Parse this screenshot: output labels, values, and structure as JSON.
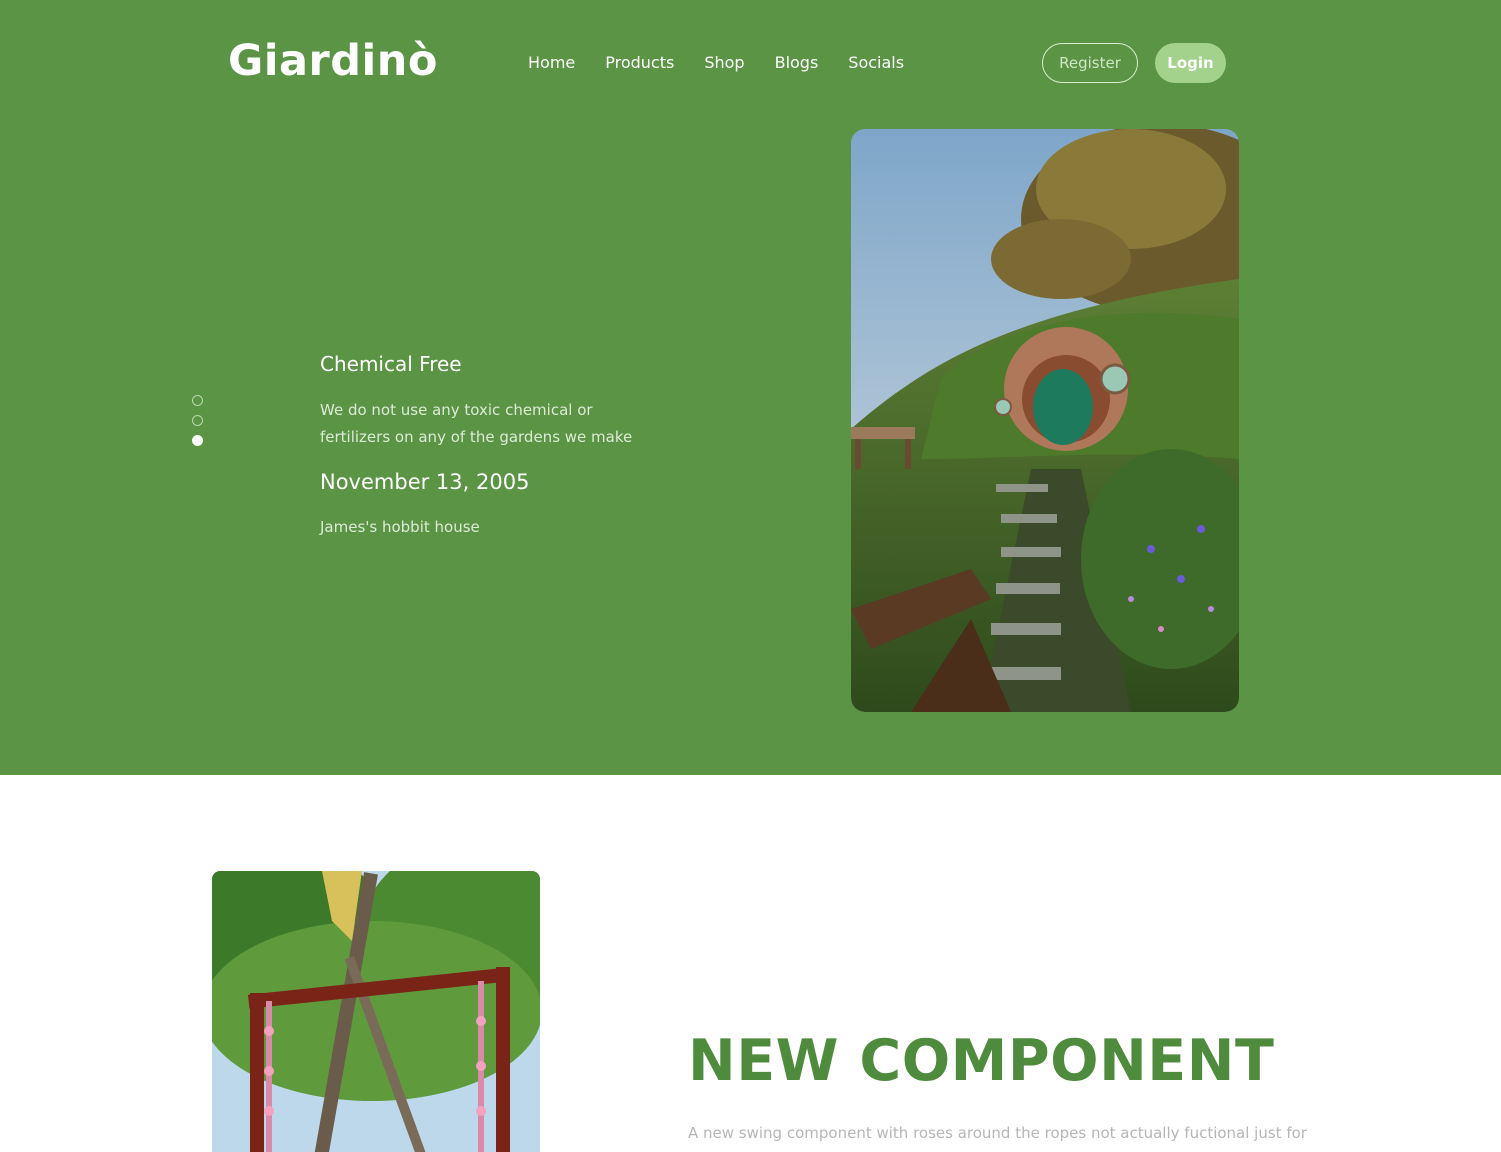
{
  "brand": {
    "logo_text": "Giardinò"
  },
  "nav": {
    "items": [
      {
        "label": "Home"
      },
      {
        "label": "Products"
      },
      {
        "label": "Shop"
      },
      {
        "label": "Blogs"
      },
      {
        "label": "Socials"
      }
    ]
  },
  "auth": {
    "register_label": "Register",
    "login_label": "Login"
  },
  "carousel": {
    "total_slides": 3,
    "active_slide": 3
  },
  "hero": {
    "feature_title": "Chemical Free",
    "feature_description": "We do not use any toxic chemical or fertilizers on any of the gardens we make",
    "date": "November 13, 2005",
    "caption": "James's hobbit house"
  },
  "section": {
    "title": "NEW COMPONENT",
    "description": "A new swing component with roses around the ropes not actually fuctional just for"
  },
  "colors": {
    "hero_bg": "#5b9445",
    "accent_green": "#4f8b3c",
    "login_bg": "#a3d28c",
    "page_bg": "#ffffff"
  }
}
